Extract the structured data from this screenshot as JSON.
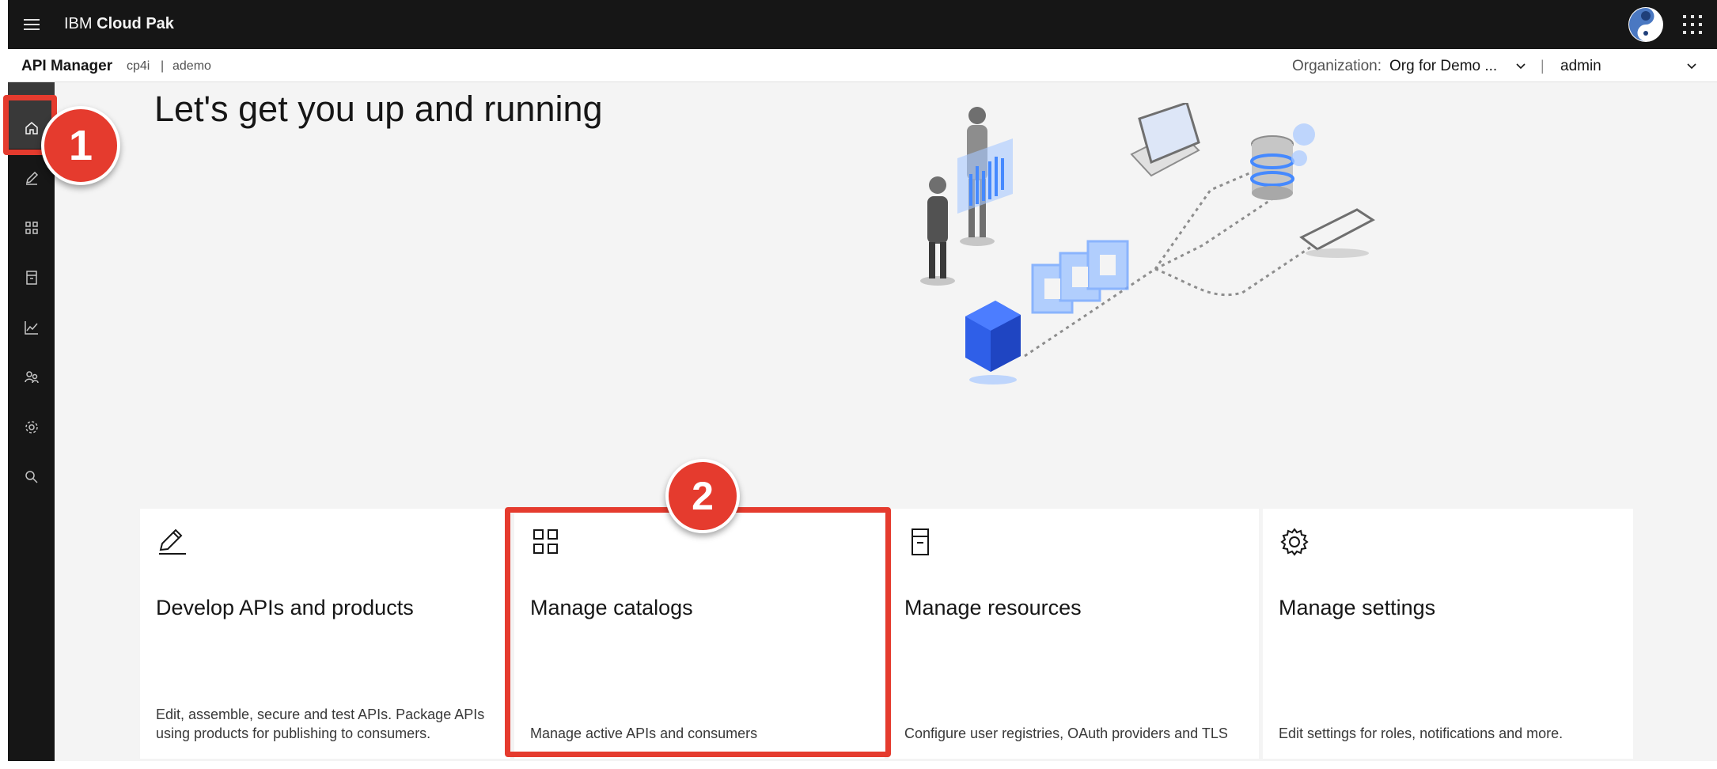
{
  "topbar": {
    "brand_light": "IBM",
    "brand_bold": "Cloud Pak"
  },
  "header": {
    "app_name": "API Manager",
    "breadcrumb": [
      "cp4i",
      "|",
      "ademo"
    ],
    "org_label": "Organization:",
    "org_value": "Org for Demo ...",
    "separator": "|",
    "user": "admin"
  },
  "sidenav": {
    "items": [
      {
        "name": "home",
        "icon": "home-icon",
        "active": true
      },
      {
        "name": "develop",
        "icon": "pencil-icon",
        "active": false
      },
      {
        "name": "manage",
        "icon": "grid-icon",
        "active": false
      },
      {
        "name": "resources",
        "icon": "server-icon",
        "active": false
      },
      {
        "name": "analytics",
        "icon": "chart-line-icon",
        "active": false
      },
      {
        "name": "members",
        "icon": "users-icon",
        "active": false
      },
      {
        "name": "settings",
        "icon": "gear-icon",
        "active": false
      },
      {
        "name": "search",
        "icon": "search-icon",
        "active": false
      }
    ]
  },
  "hero": {
    "title": "Let's get you up and running"
  },
  "tiles": [
    {
      "icon": "pencil-icon",
      "title": "Develop APIs and products",
      "description": "Edit, assemble, secure and test APIs. Package APIs using products for publishing to consumers."
    },
    {
      "icon": "grid-icon",
      "title": "Manage catalogs",
      "description": "Manage active APIs and consumers"
    },
    {
      "icon": "server-icon",
      "title": "Manage resources",
      "description": "Configure user registries, OAuth providers and TLS"
    },
    {
      "icon": "gear-icon",
      "title": "Manage settings",
      "description": "Edit settings for roles, notifications and more."
    }
  ],
  "annotations": {
    "step1": "1",
    "step2": "2",
    "highlight_color": "#e53b2e"
  },
  "colors": {
    "shell": "#161616",
    "background": "#f4f4f4",
    "accent_blue": "#3370ff"
  }
}
